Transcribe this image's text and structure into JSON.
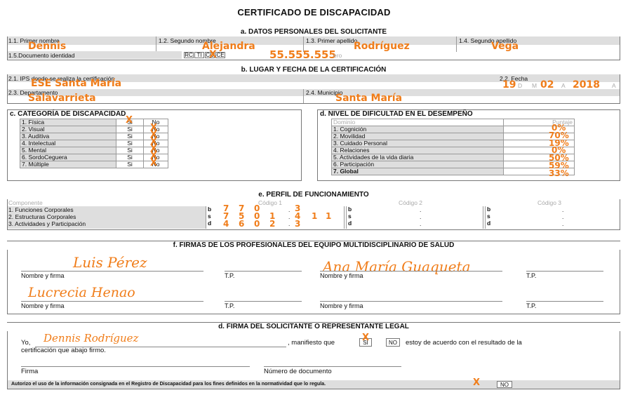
{
  "title": "CERTIFICADO DE DISCAPACIDAD",
  "sec_a": {
    "header": "a. DATOS PERSONALES DEL SOLICITANTE",
    "f1_label": "1.1. Primer nombre",
    "f1_value": "Dennis",
    "f2_label": "1.2. Segundo nombre",
    "f2_value": "Alejandra",
    "f3_label": "1.3. Primer apellido",
    "f3_value": "Rodríguez",
    "f4_label": "1.4. Segundo apellido",
    "f4_value": "Vega",
    "doc_label": "1.5.Documento identidad",
    "doc_types": [
      "RC",
      "TI",
      "CC",
      "CE"
    ],
    "doc_mark": "X",
    "doc_number": "55.555.555",
    "doc_number_hint": "ero"
  },
  "sec_b": {
    "header": "b. LUGAR Y FECHA DE LA CERTIFICACIÓN",
    "ips_label": "2.1. IPS donde se realiza la certificación",
    "ips_value": "ESE Santa María",
    "date_label": "2.2. Fecha",
    "date_day": "19",
    "date_month": "02",
    "date_year": "2018",
    "date_hints": [
      "D",
      "M",
      "A",
      "A"
    ],
    "dept_label": "2.3. Departamento",
    "dept_value": "Salavarrieta",
    "mun_label": "2.4. Municipio",
    "mun_value": "Santa María"
  },
  "sec_c": {
    "header": "c. CATEGORÍA DE DISCAPACIDAD",
    "si": "Si",
    "no": "No",
    "mark": "X",
    "items": [
      "1. Física",
      "2. Visual",
      "3. Auditiva",
      "4. Intelectual",
      "5. Mental",
      "6. SordoCeguera",
      "7. Múltiple"
    ]
  },
  "sec_d": {
    "header": "d. NIVEL DE DIFICULTAD EN EL DESEMPEÑO",
    "col_domain": "Dominio",
    "col_score": "Puntaje",
    "rows": [
      {
        "label": "1. Cognición",
        "value": "0%"
      },
      {
        "label": "2. Movilidad",
        "value": "70%"
      },
      {
        "label": "3. Cuidado Personal",
        "value": "19%"
      },
      {
        "label": "4. Relaciones",
        "value": "0%"
      },
      {
        "label": "5. Actividades de la vida diaria",
        "value": "50%"
      },
      {
        "label": "6. Participación",
        "value": "59%"
      },
      {
        "label": "7. Global",
        "value": "33%"
      }
    ]
  },
  "sec_e": {
    "header": "e. PERFIL DE FUNCIONAMIENTO",
    "col_component": "Componente",
    "codes": [
      "Código 1",
      "Código 2",
      "Código 3"
    ],
    "rows": [
      "1. Funciones Corporales",
      "2. Estructuras Corporales",
      "3. Actividades y Participación"
    ],
    "prefixes": [
      "b",
      "s",
      "d"
    ],
    "dot": ".",
    "code1_values": [
      [
        "7",
        "7",
        "0",
        "",
        "3",
        "",
        ""
      ],
      [
        "7",
        "5",
        "0",
        "1",
        "4",
        "1",
        "1"
      ],
      [
        "4",
        "6",
        "0",
        "2",
        "3",
        "",
        ""
      ]
    ]
  },
  "sec_f": {
    "header": "f. FIRMAS DE LOS PROFESIONALES DEL EQUIPO MULTIDISCIPLINARIO DE SALUD",
    "sig1": "Luis Pérez",
    "sig2": "Ana María Guaqueta",
    "sig3": "Lucrecia Henao",
    "name_label": "Nombre y firma",
    "tp_label": "T.P."
  },
  "sec_g": {
    "header": "d. FIRMA DEL SOLICITANTE O REPRESENTANTE LEGAL",
    "yo": "Yo,",
    "name": "Dennis Rodríguez",
    "manifest": ", manifiesto que",
    "yes_box": "SI",
    "yes_mark": "X",
    "no_box": "NO",
    "agree": "estoy de acuerdo con el resultado de la",
    "line2": "certificación que abajo firmo.",
    "firma": "Firma",
    "doc": "Número de documento",
    "auth": "Autorizo el uso de la información consignada en el Registro de Discapacidad para los fines definidos en la normatividad que lo regula.",
    "auth_mark": "X",
    "auth_no": "NO"
  }
}
